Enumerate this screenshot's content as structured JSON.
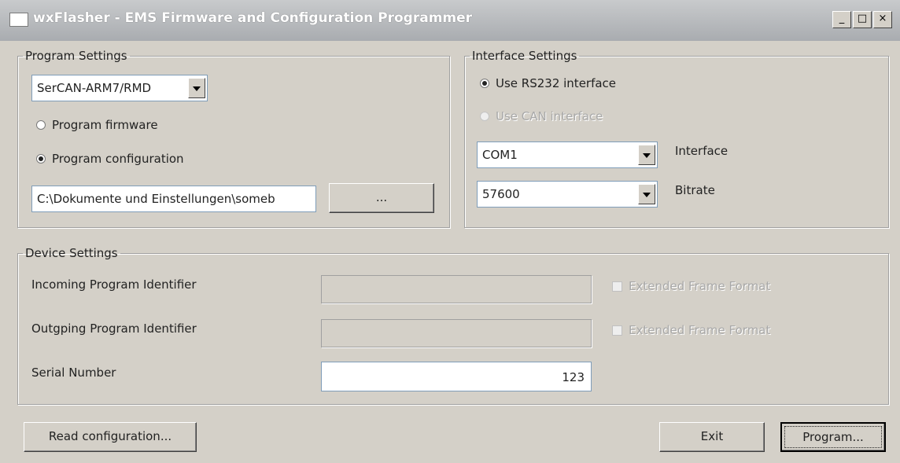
{
  "window": {
    "title": "wxFlasher - EMS Firmware and Configuration Programmer",
    "minimize": "_",
    "maximize": "□",
    "close": "×"
  },
  "program_settings": {
    "legend": "Program Settings",
    "device_select": "SerCAN-ARM7/RMD",
    "radio_firmware": "Program firmware",
    "radio_configuration": "Program configuration",
    "selected": "configuration",
    "path_value": "C:\\Dokumente und Einstellungen\\someb",
    "browse_label": "..."
  },
  "interface_settings": {
    "legend": "Interface Settings",
    "radio_rs232": "Use RS232 interface",
    "radio_can": "Use CAN interface",
    "interface_value": "COM1",
    "interface_label": "Interface",
    "bitrate_value": "57600",
    "bitrate_label": "Bitrate"
  },
  "device_settings": {
    "legend": "Device Settings",
    "incoming_label": "Incoming Program Identifier",
    "incoming_value": "",
    "incoming_ext": "Extended Frame Format",
    "outgoing_label": "Outgping Program Identifier",
    "outgoing_value": "",
    "outgoing_ext": "Extended Frame Format",
    "serial_label": "Serial Number",
    "serial_value": "123"
  },
  "buttons": {
    "read_config": "Read configuration...",
    "exit": "Exit",
    "program": "Program..."
  }
}
